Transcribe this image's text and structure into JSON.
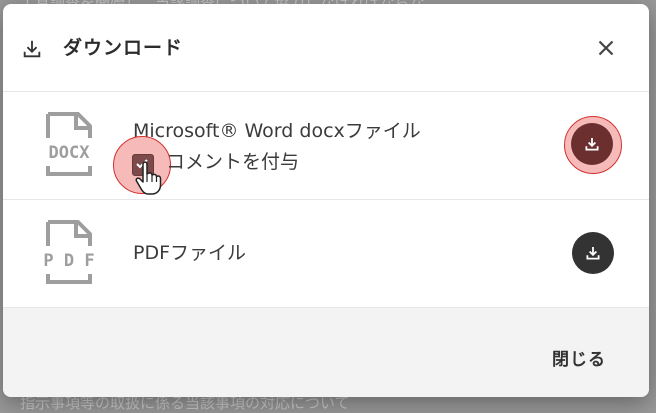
{
  "backdrop": {
    "top_text": "工具調査を開始し、当該調査について協力しなければならな",
    "bottom_text": "指示事項等の取扱に係る当該事項の対応について"
  },
  "dialog": {
    "title": "ダウンロード",
    "close_icon": "close-icon",
    "download_icon": "download-icon"
  },
  "files": [
    {
      "icon_label": "DOCX",
      "name": "Microsoft® Word docxファイル",
      "option_label": "コメントを付与",
      "option_checked": true
    },
    {
      "icon_label": "P D F",
      "name": "PDFファイル"
    }
  ],
  "footer": {
    "close_label": "閉じる"
  },
  "colors": {
    "accent_highlight": "#e53935",
    "download_button": "#333333",
    "download_button_active": "#6b2f2f",
    "checkbox": "#7c4a4a"
  }
}
